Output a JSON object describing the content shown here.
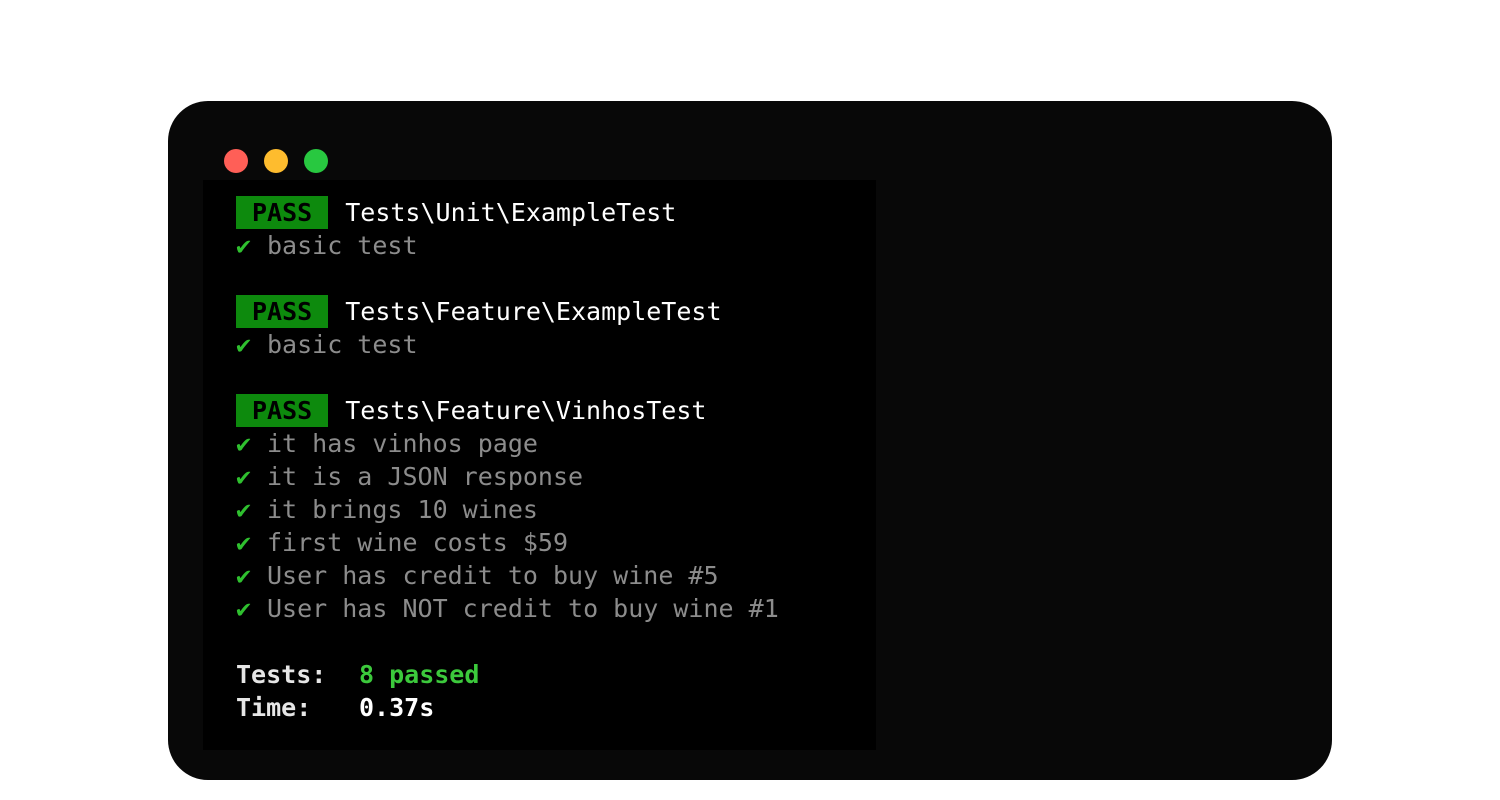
{
  "colors": {
    "close": "#ff5f57",
    "minimize": "#febc2e",
    "zoom": "#28c840",
    "pass_bg": "#0d8a0d",
    "pass_text": "#000000",
    "check": "#2fc02f",
    "passed_text": "#3cc93c"
  },
  "window_controls": [
    {
      "name": "close",
      "icon": "circle-red"
    },
    {
      "name": "minimize",
      "icon": "circle-yellow"
    },
    {
      "name": "zoom",
      "icon": "circle-green"
    }
  ],
  "suites": [
    {
      "status": "PASS",
      "name": "Tests\\Unit\\ExampleTest",
      "tests": [
        "basic test"
      ]
    },
    {
      "status": "PASS",
      "name": "Tests\\Feature\\ExampleTest",
      "tests": [
        "basic test"
      ]
    },
    {
      "status": "PASS",
      "name": "Tests\\Feature\\VinhosTest",
      "tests": [
        "it has vinhos page",
        "it is a JSON response",
        "it brings 10 wines",
        "first wine costs $59",
        "User has credit to buy wine #5",
        "User has NOT credit to buy wine #1"
      ]
    }
  ],
  "check_glyph": "✔",
  "summary": {
    "tests_label": "Tests:",
    "tests_value": "8 passed",
    "time_label": "Time:",
    "time_value": "0.37s"
  }
}
